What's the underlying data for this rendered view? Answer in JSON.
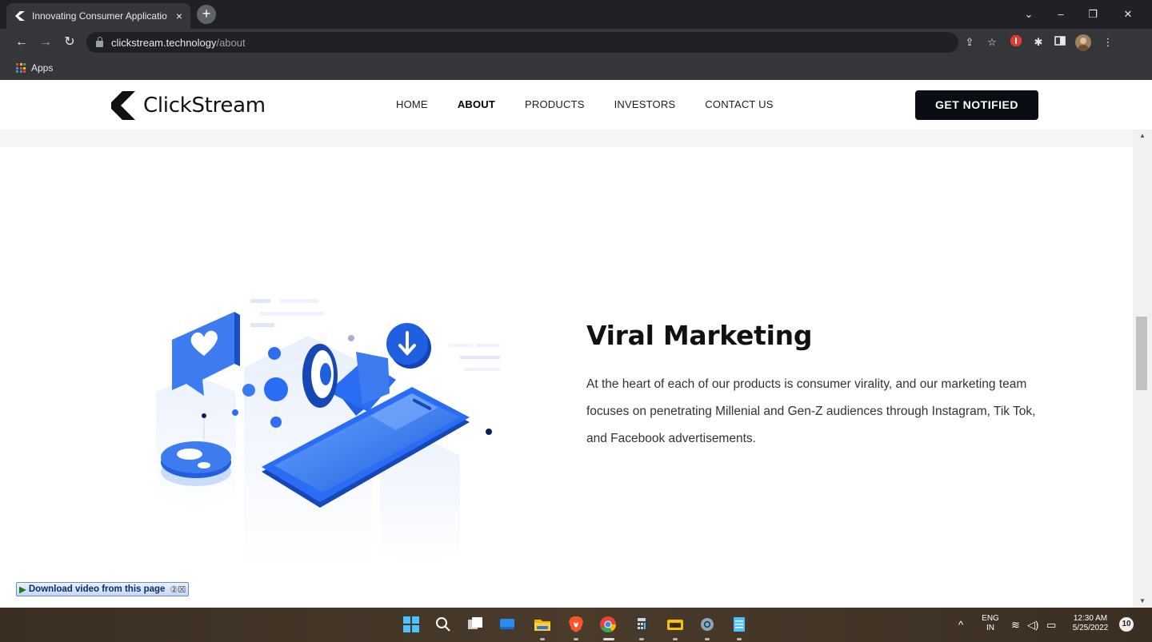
{
  "browser": {
    "tab_title": "Innovating Consumer Applicatio",
    "tab_close": "×",
    "new_tab": "+",
    "url_host": "clickstream.technology",
    "url_path": "/about",
    "bookmark_apps": "Apps",
    "window_controls": {
      "tabsearch": "⌄",
      "minimize": "–",
      "restore": "❐",
      "close": "✕"
    }
  },
  "site": {
    "logo_text": "ClickStream",
    "nav": {
      "home": "HOME",
      "about": "ABOUT",
      "products": "PRODUCTS",
      "investors": "INVESTORS",
      "contact": "CONTACT US"
    },
    "cta": "GET NOTIFIED",
    "hero": {
      "title": "Viral Marketing",
      "body": "At the heart of each of our products is consumer virality, and our marketing team focuses on penetrating Millenial and Gen-Z audiences through Instagram, Tik Tok, and Facebook advertisements."
    },
    "download_bar": {
      "label": "Download video from this page",
      "extra": "②☒"
    }
  },
  "taskbar": {
    "lang_top": "ENG",
    "lang_bottom": "IN",
    "time": "12:30 AM",
    "date": "5/25/2022",
    "notifications": "10"
  },
  "colors": {
    "accent_blue": "#2a6df4",
    "cta_bg": "#0a0e14",
    "chrome_dark": "#202124",
    "chrome_toolbar": "#35363a"
  }
}
